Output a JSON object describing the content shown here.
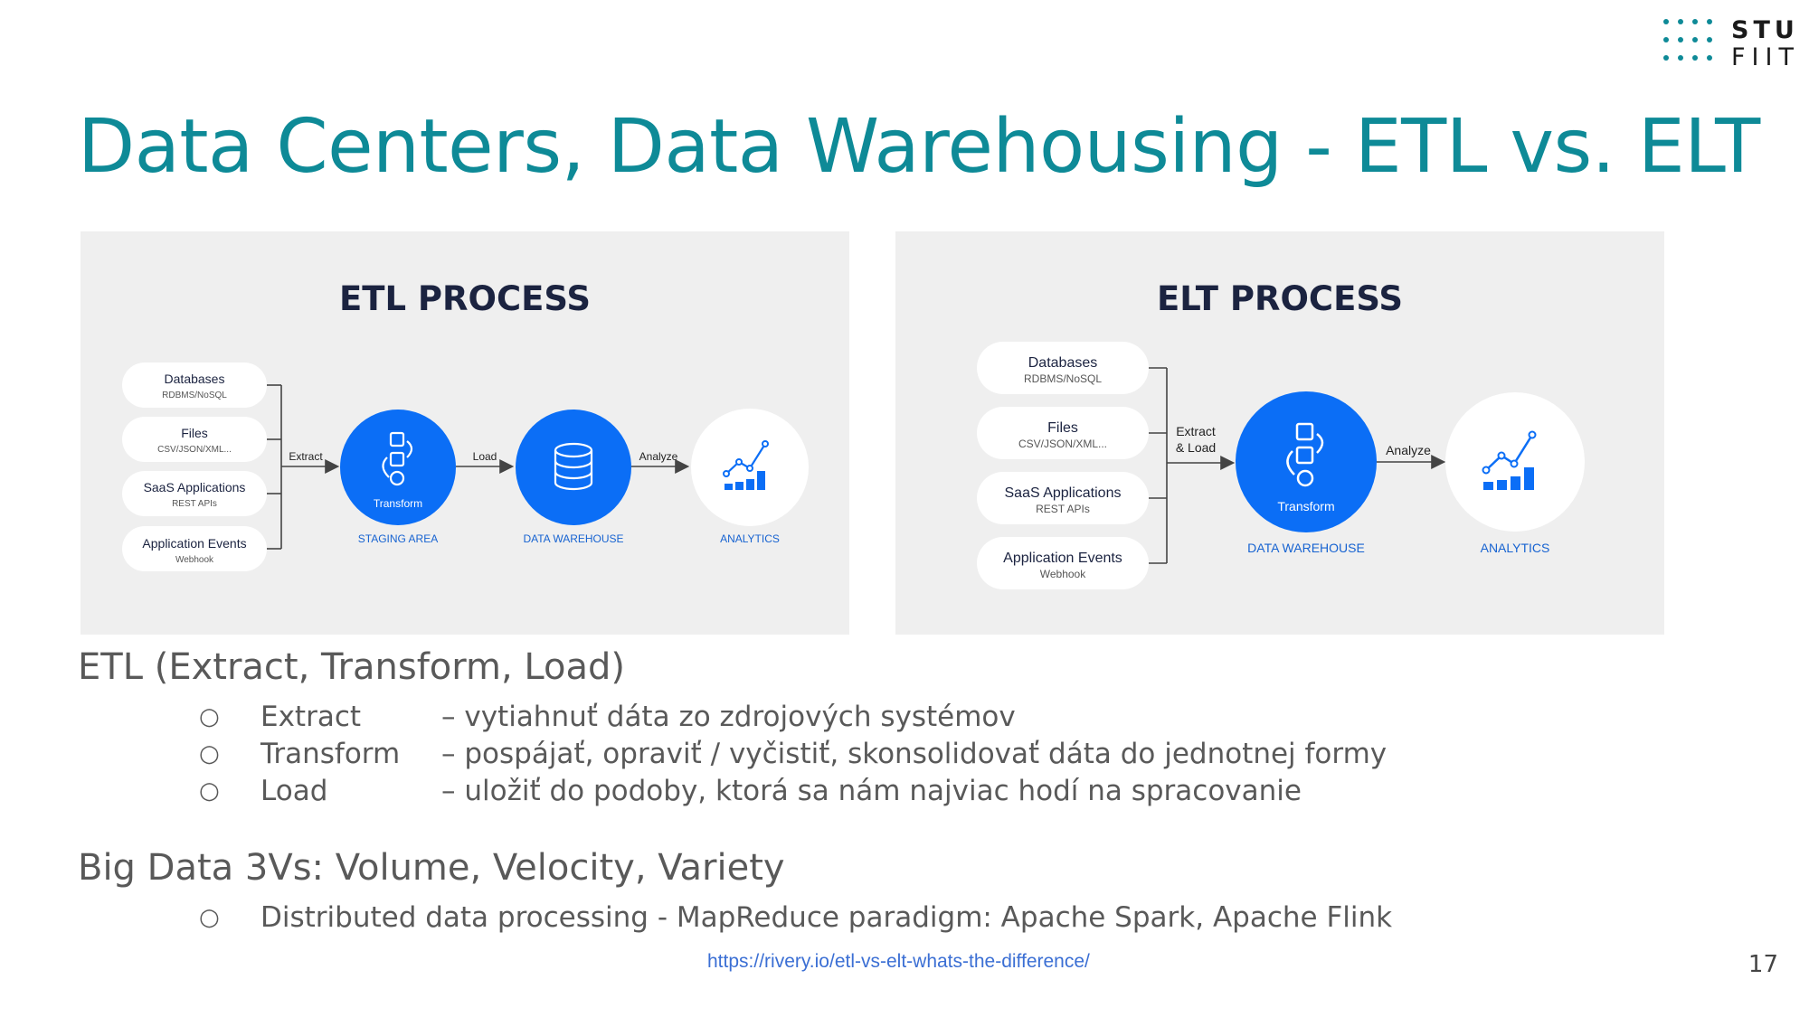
{
  "logo": {
    "line1": "STU",
    "line2": "FIIT"
  },
  "slide": {
    "title": "Data Centers, Data Warehousing - ETL vs. ELT",
    "page_number": "17"
  },
  "etl_diagram": {
    "heading": "ETL PROCESS",
    "sources": [
      {
        "name": "Databases",
        "sub": "RDBMS/NoSQL"
      },
      {
        "name": "Files",
        "sub": "CSV/JSON/XML..."
      },
      {
        "name": "SaaS Applications",
        "sub": "REST APIs"
      },
      {
        "name": "Application Events",
        "sub": "Webhook"
      }
    ],
    "edges": {
      "extract": "Extract",
      "load": "Load",
      "analyze": "Analyze"
    },
    "nodes": {
      "transform": "Transform",
      "staging": "STAGING AREA",
      "warehouse": "DATA WAREHOUSE",
      "analytics": "ANALYTICS"
    }
  },
  "elt_diagram": {
    "heading": "ELT PROCESS",
    "sources": [
      {
        "name": "Databases",
        "sub": "RDBMS/NoSQL"
      },
      {
        "name": "Files",
        "sub": "CSV/JSON/XML..."
      },
      {
        "name": "SaaS Applications",
        "sub": "REST APIs"
      },
      {
        "name": "Application Events",
        "sub": "Webhook"
      }
    ],
    "edges": {
      "extract_line1": "Extract",
      "extract_line2": "& Load",
      "analyze": "Analyze"
    },
    "nodes": {
      "transform": "Transform",
      "warehouse": "DATA WAREHOUSE",
      "analytics": "ANALYTICS"
    }
  },
  "etl_section": {
    "heading": "ETL (Extract, Transform, Load)",
    "bullet_symbol": "○",
    "items": [
      {
        "term": "Extract",
        "desc": "– vytiahnuť dáta zo zdrojových systémov"
      },
      {
        "term": "Transform",
        "desc": "– pospájať, opraviť / vyčistiť, skonsolidovať dáta do jednotnej formy"
      },
      {
        "term": "Load",
        "desc": "– uložiť do podoby, ktorá sa nám najviac hodí na spracovanie"
      }
    ]
  },
  "bigdata_section": {
    "heading": "Big Data 3Vs: Volume, Velocity, Variety",
    "items": [
      "Distributed data processing - MapReduce paradigm: Apache Spark, Apache Flink"
    ]
  },
  "source_link": "https://rivery.io/etl-vs-elt-whats-the-difference/",
  "colors": {
    "title_teal": "#0e8a97",
    "node_blue": "#0b6ef6",
    "heading_navy": "#1b2340",
    "label_blue": "#1763d1"
  }
}
